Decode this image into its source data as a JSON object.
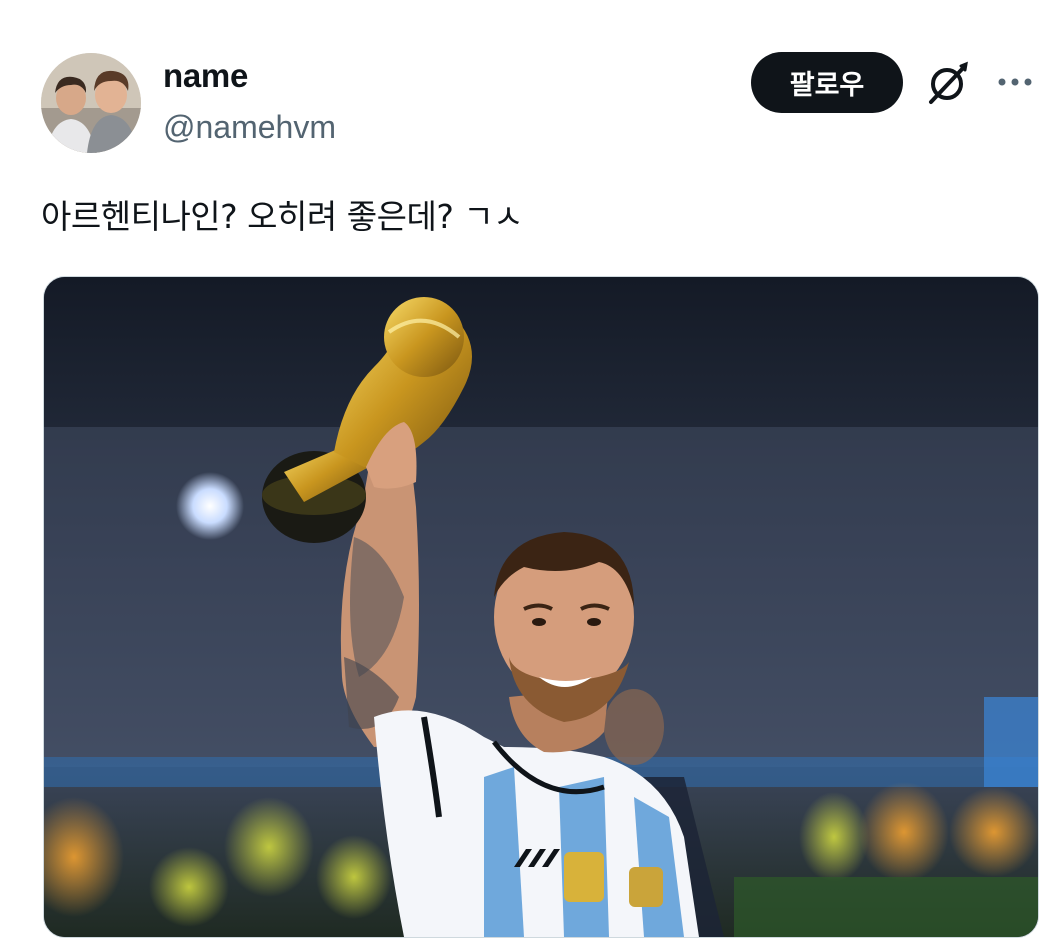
{
  "author": {
    "display_name": "name",
    "handle": "@namehvm",
    "avatar_icon": "avatar-photo"
  },
  "actions": {
    "follow_label": "팔로우",
    "grok_icon": "grok-icon",
    "more_icon": "more-dots-icon"
  },
  "post": {
    "text": "아르헨티나인? 오히려 좋은데? ㄱㅅ"
  },
  "media": {
    "type": "photo",
    "icon": "photo-image"
  },
  "colors": {
    "text_primary": "#0f1419",
    "text_secondary": "#536471",
    "button_bg": "#0f1419",
    "button_text": "#ffffff",
    "border": "#cfd9de"
  }
}
